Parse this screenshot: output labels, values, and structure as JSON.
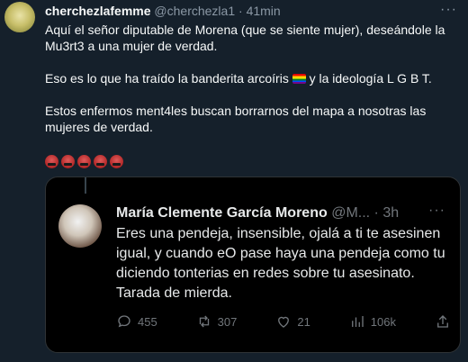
{
  "outer_tweet": {
    "display_name": "cherchezlafemme",
    "handle": "@cherchezla1",
    "separator": " · ",
    "time": "41min",
    "more_icon": "more-icon",
    "paragraphs": [
      "Aquí el señor diputable de Morena (que se siente mujer), deseándole la Mu3rt3 a una mujer de verdad.",
      "Eso es lo que ha traído la banderita arcoíris",
      "y la ideología L G B T.",
      "Estos enfermos ment4les buscan borrarnos del mapa a nosotras las mujeres de verdad."
    ],
    "emoji": [
      "angry-face-icon",
      "angry-face-icon",
      "angry-face-icon",
      "angry-face-icon",
      "angry-face-icon"
    ]
  },
  "quoted_tweet": {
    "display_name": "María Clemente García Moreno",
    "handle": "@M...",
    "separator": " · ",
    "time": "3h",
    "text": "Eres una pendeja, insensible, ojalá a ti te asesinen igual, y cuando eO pase haya una pendeja como tu diciendo tonterias en redes sobre tu asesinato. Tarada de mierda.",
    "actions": {
      "reply": "455",
      "retweet": "307",
      "like": "21",
      "views": "106k"
    }
  }
}
